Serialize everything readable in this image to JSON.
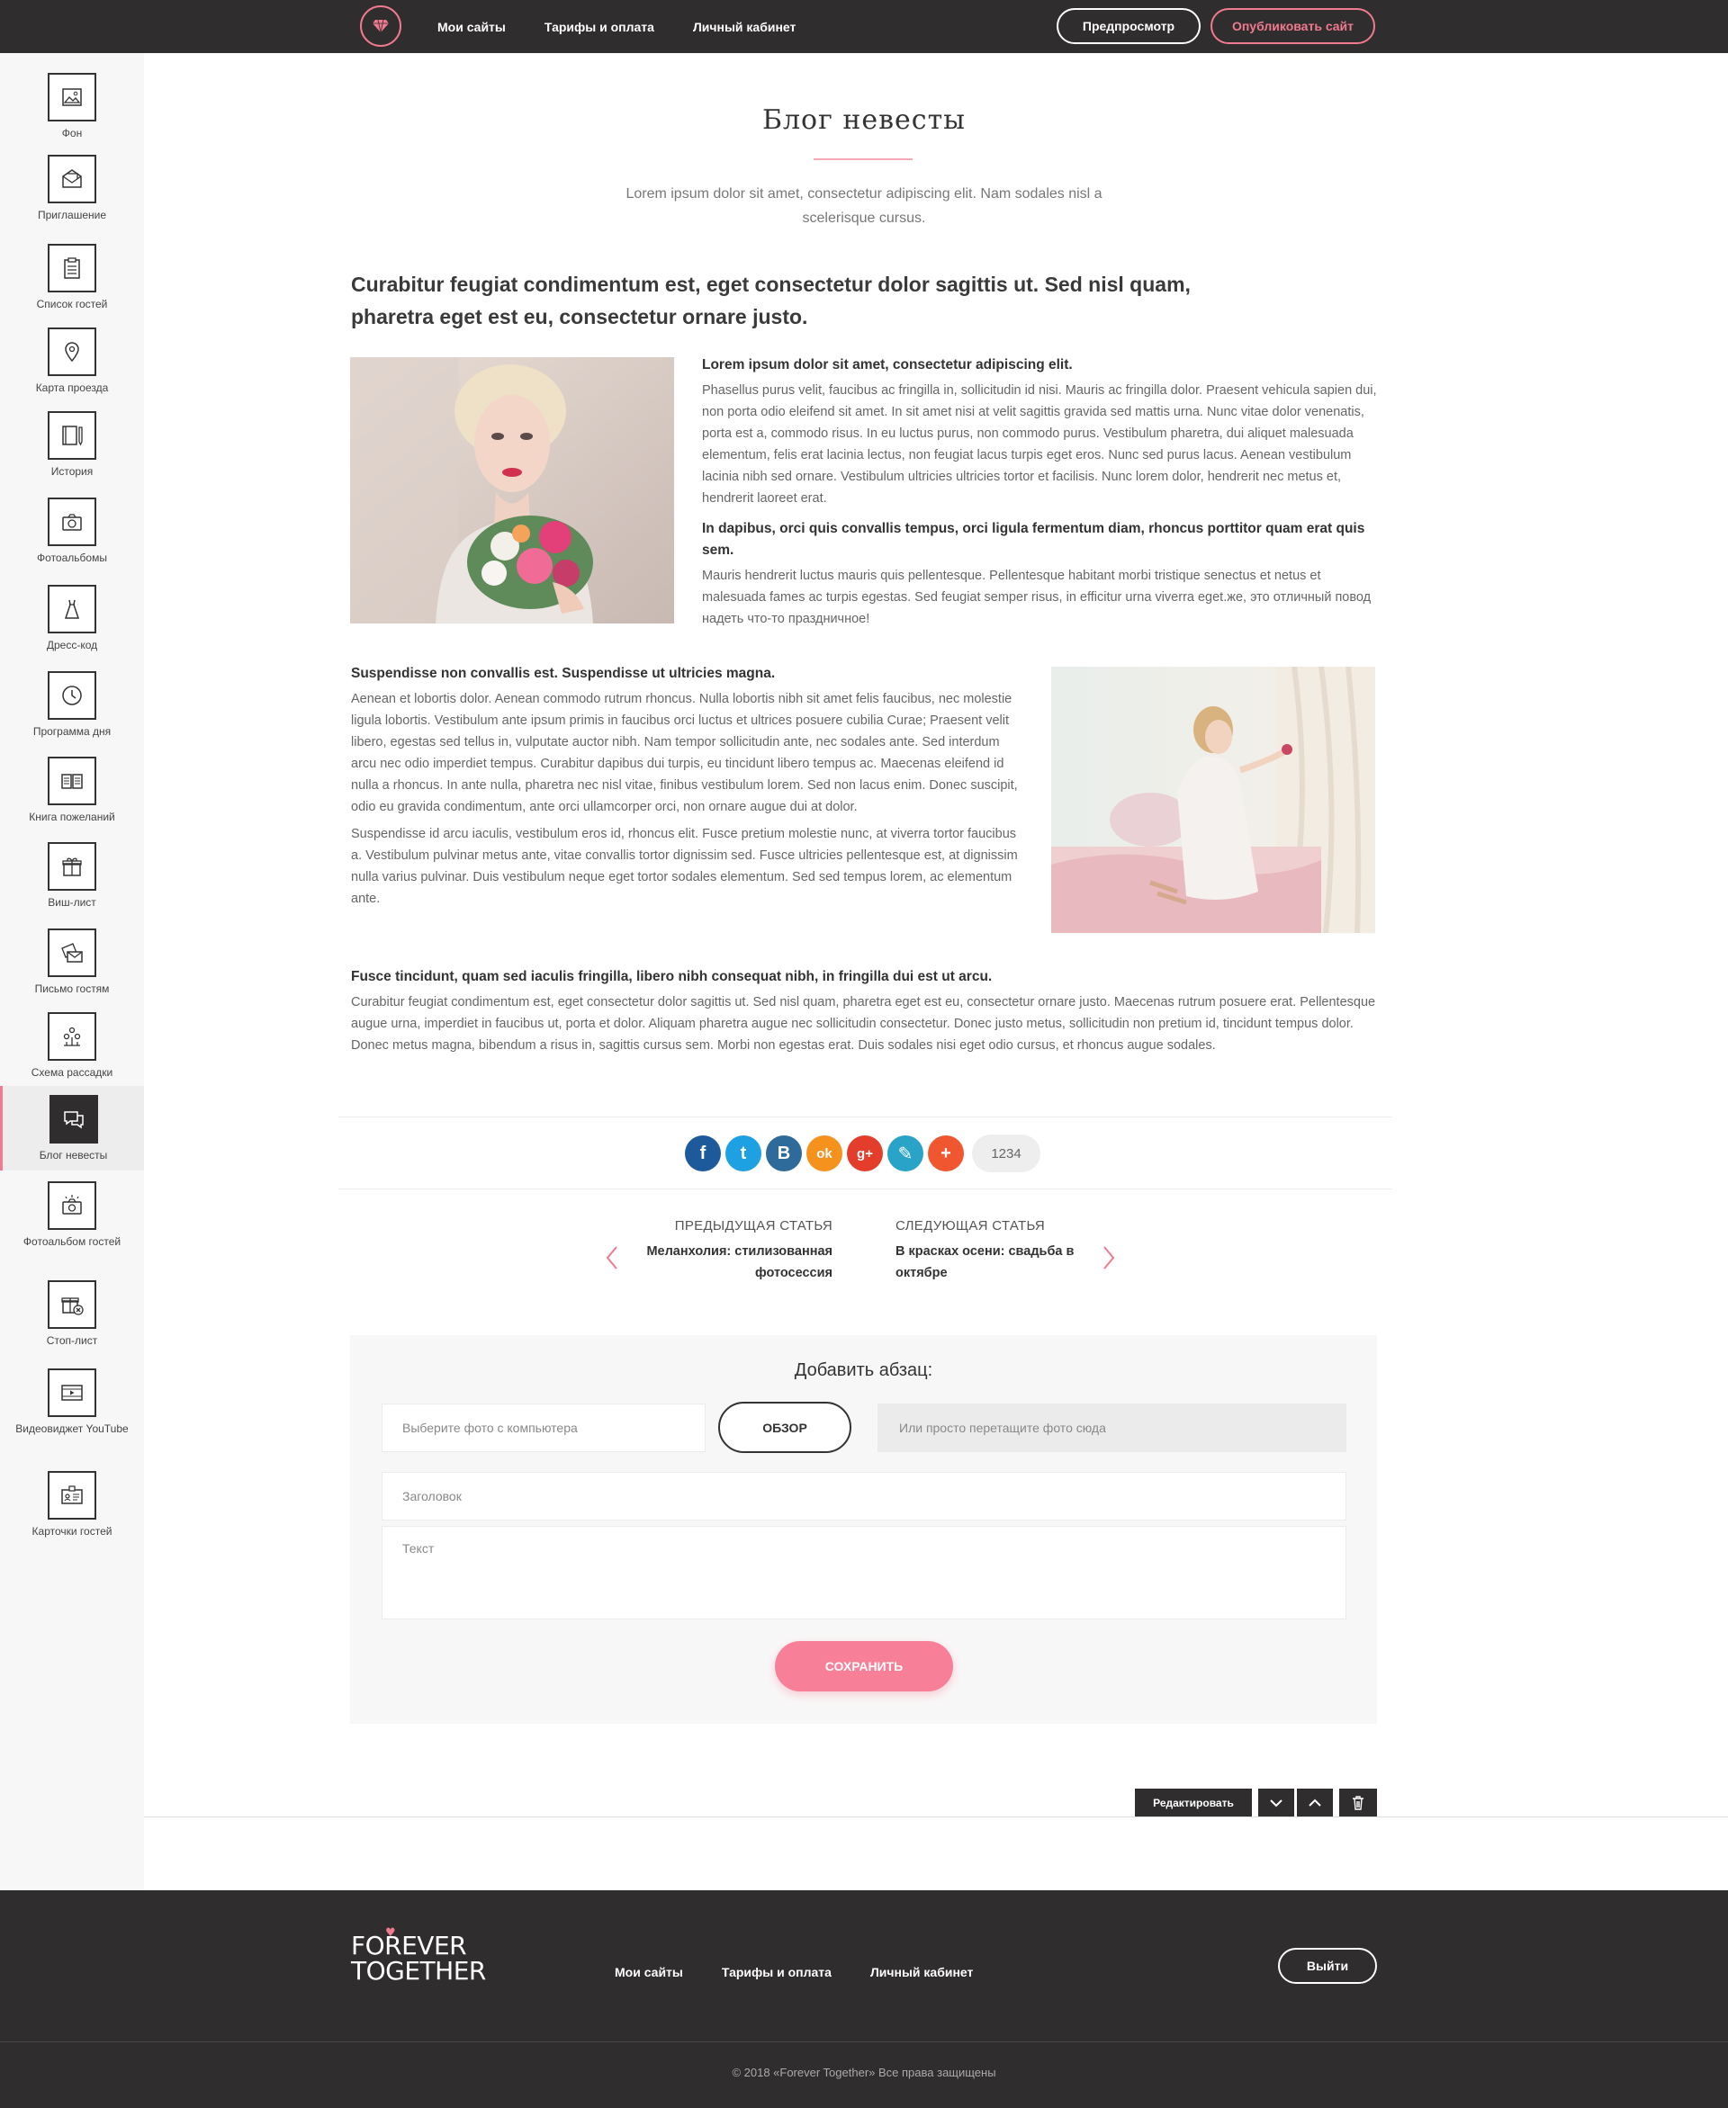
{
  "topbar": {
    "nav": [
      "Мои сайты",
      "Тарифы и оплата",
      "Личный кабинет"
    ],
    "preview_label": "Предпросмотр",
    "publish_label": "Опубликовать сайт"
  },
  "sidebar": {
    "items": [
      {
        "label": "Фон",
        "icon": "image-icon"
      },
      {
        "label": "Приглашение",
        "icon": "envelope-icon"
      },
      {
        "label": "Список гостей",
        "icon": "clipboard-icon"
      },
      {
        "label": "Карта проезда",
        "icon": "map-pin-icon"
      },
      {
        "label": "История",
        "icon": "book-pen-icon"
      },
      {
        "label": "Фотоальбомы",
        "icon": "camera-icon"
      },
      {
        "label": "Дресс-код",
        "icon": "dress-icon"
      },
      {
        "label": "Программа дня",
        "icon": "clock-icon"
      },
      {
        "label": "Книга пожеланий",
        "icon": "open-book-icon"
      },
      {
        "label": "Виш-лист",
        "icon": "gift-icon"
      },
      {
        "label": "Письмо гостям",
        "icon": "letters-icon"
      },
      {
        "label": "Схема рассадки",
        "icon": "seating-icon"
      },
      {
        "label": "Блог невесты",
        "icon": "chat-icon"
      },
      {
        "label": "Фотоальбом гостей",
        "icon": "camera-guests-icon"
      },
      {
        "label": "Стоп-лист",
        "icon": "gift-stop-icon"
      },
      {
        "label": "Видеовиджет YouTube",
        "icon": "video-icon"
      },
      {
        "label": "Карточки гостей",
        "icon": "card-icon"
      }
    ],
    "active_index": 12
  },
  "main": {
    "title": "Блог невесты",
    "intro": "Lorem ipsum dolor sit amet, consectetur adipiscing elit. Nam sodales nisl a scelerisque cursus.",
    "lead": "Curabitur feugiat condimentum est, eget consectetur dolor sagittis ut. Sed nisl quam, pharetra eget est eu, consectetur ornare justo.",
    "block1": {
      "h1": "Lorem ipsum dolor sit amet, consectetur adipiscing elit.",
      "p1": "Phasellus purus velit, faucibus ac fringilla in, sollicitudin id nisi. Mauris ac fringilla dolor. Praesent vehicula sapien dui, non porta odio eleifend sit amet. In sit amet nisi at velit sagittis gravida sed mattis urna. Nunc vitae dolor venenatis, porta est a, commodo risus. In eu luctus purus, non commodo purus. Vestibulum pharetra, dui aliquet malesuada elementum, felis erat lacinia lectus, non feugiat lacus turpis eget eros. Nunc sed purus lacus. Aenean vestibulum lacinia nibh sed ornare. Vestibulum ultricies ultricies tortor et facilisis. Nunc lorem dolor, hendrerit nec metus et, hendrerit laoreet erat.",
      "h2": "In dapibus, orci quis convallis tempus, orci ligula fermentum diam, rhoncus porttitor quam erat quis sem.",
      "p2": "Mauris hendrerit luctus mauris quis pellentesque. Pellentesque habitant morbi tristique senectus et netus et malesuada fames ac turpis egestas. Sed feugiat semper risus, in efficitur urna viverra eget.же, это отличный повод надеть что-то праздничное!"
    },
    "block2": {
      "h": "Suspendisse non convallis est. Suspendisse ut ultricies magna.",
      "p1": "Aenean et lobortis dolor. Aenean commodo rutrum rhoncus. Nulla lobortis nibh sit amet felis faucibus, nec molestie ligula lobortis. Vestibulum ante ipsum primis in faucibus orci luctus et ultrices posuere cubilia Curae; Praesent velit libero, egestas sed tellus in, vulputate auctor nibh. Nam tempor sollicitudin ante, nec sodales ante. Sed interdum arcu nec odio imperdiet tempus. Curabitur dapibus dui turpis, eu tincidunt libero tempus ac. Maecenas eleifend id nulla a rhoncus. In ante nulla, pharetra nec nisl vitae, finibus vestibulum lorem. Sed non lacus enim. Donec suscipit, odio eu gravida condimentum, ante orci ullamcorper orci, non ornare augue dui at dolor.",
      "p2": "Suspendisse id arcu iaculis, vestibulum eros id, rhoncus elit. Fusce pretium molestie nunc, at viverra tortor faucibus a. Vestibulum pulvinar metus ante, vitae convallis tortor dignissim sed. Fusce ultricies pellentesque est, at dignissim nulla varius pulvinar. Duis vestibulum neque eget tortor sodales elementum. Sed sed tempus lorem, ac elementum ante."
    },
    "block3": {
      "h": "Fusce tincidunt, quam sed iaculis fringilla, libero nibh consequat nibh, in fringilla dui est ut arcu.",
      "p": "Curabitur feugiat condimentum est, eget consectetur dolor sagittis ut. Sed nisl quam, pharetra eget est eu, consectetur ornare justo. Maecenas rutrum posuere erat. Pellentesque augue urna, imperdiet in faucibus ut, porta et dolor. Aliquam pharetra augue nec sollicitudin consectetur. Donec justo metus, sollicitudin non pretium id, tincidunt tempus dolor. Donec metus magna, bibendum a risus in, sagittis cursus sem. Morbi non egestas erat. Duis sodales nisi eget odio cursus, et rhoncus augue sodales."
    },
    "share": {
      "networks": [
        {
          "name": "facebook-icon",
          "glyph": "f",
          "color": "#1c5a9c"
        },
        {
          "name": "twitter-icon",
          "glyph": "t",
          "color": "#1da1e2"
        },
        {
          "name": "vk-icon",
          "glyph": "B",
          "color": "#2e6a9a"
        },
        {
          "name": "odnoklassniki-icon",
          "glyph": "ok",
          "color": "#f5921e"
        },
        {
          "name": "google-plus-icon",
          "glyph": "g+",
          "color": "#e43d2b"
        },
        {
          "name": "livejournal-icon",
          "glyph": "✎",
          "color": "#2aa3c9"
        },
        {
          "name": "more-plus-icon",
          "glyph": "+",
          "color": "#f0562f"
        }
      ],
      "count": "1234"
    },
    "nav": {
      "prev_caption": "ПРЕДЫДУЩАЯ СТАТЬЯ",
      "prev_title": "Меланхолия: стилизованная фотосессия",
      "next_caption": "СЛЕДУЮЩАЯ СТАТЬЯ",
      "next_title": "В красках осени: свадьба в октябре"
    }
  },
  "form": {
    "title": "Добавить абзац:",
    "file_placeholder": "Выберите фото с компьютера",
    "browse_label": "ОБЗОР",
    "dropzone_text": "Или просто перетащите фото сюда",
    "heading_placeholder": "Заголовок",
    "text_placeholder": "Текст",
    "save_label": "СОХРАНИТЬ"
  },
  "edit_toolbar": {
    "edit_label": "Редактировать"
  },
  "footer": {
    "logo_line1": "FOREVER",
    "logo_line2": "TOGETHER",
    "nav": [
      "Мои сайты",
      "Тарифы и оплата",
      "Личный кабинет"
    ],
    "logout_label": "Выйти",
    "copyright": "© 2018 «Forever Together» Все права защищены"
  },
  "colors": {
    "accent": "#f07a8f",
    "dark": "#2f2d2d",
    "save_button": "#f87f98"
  }
}
